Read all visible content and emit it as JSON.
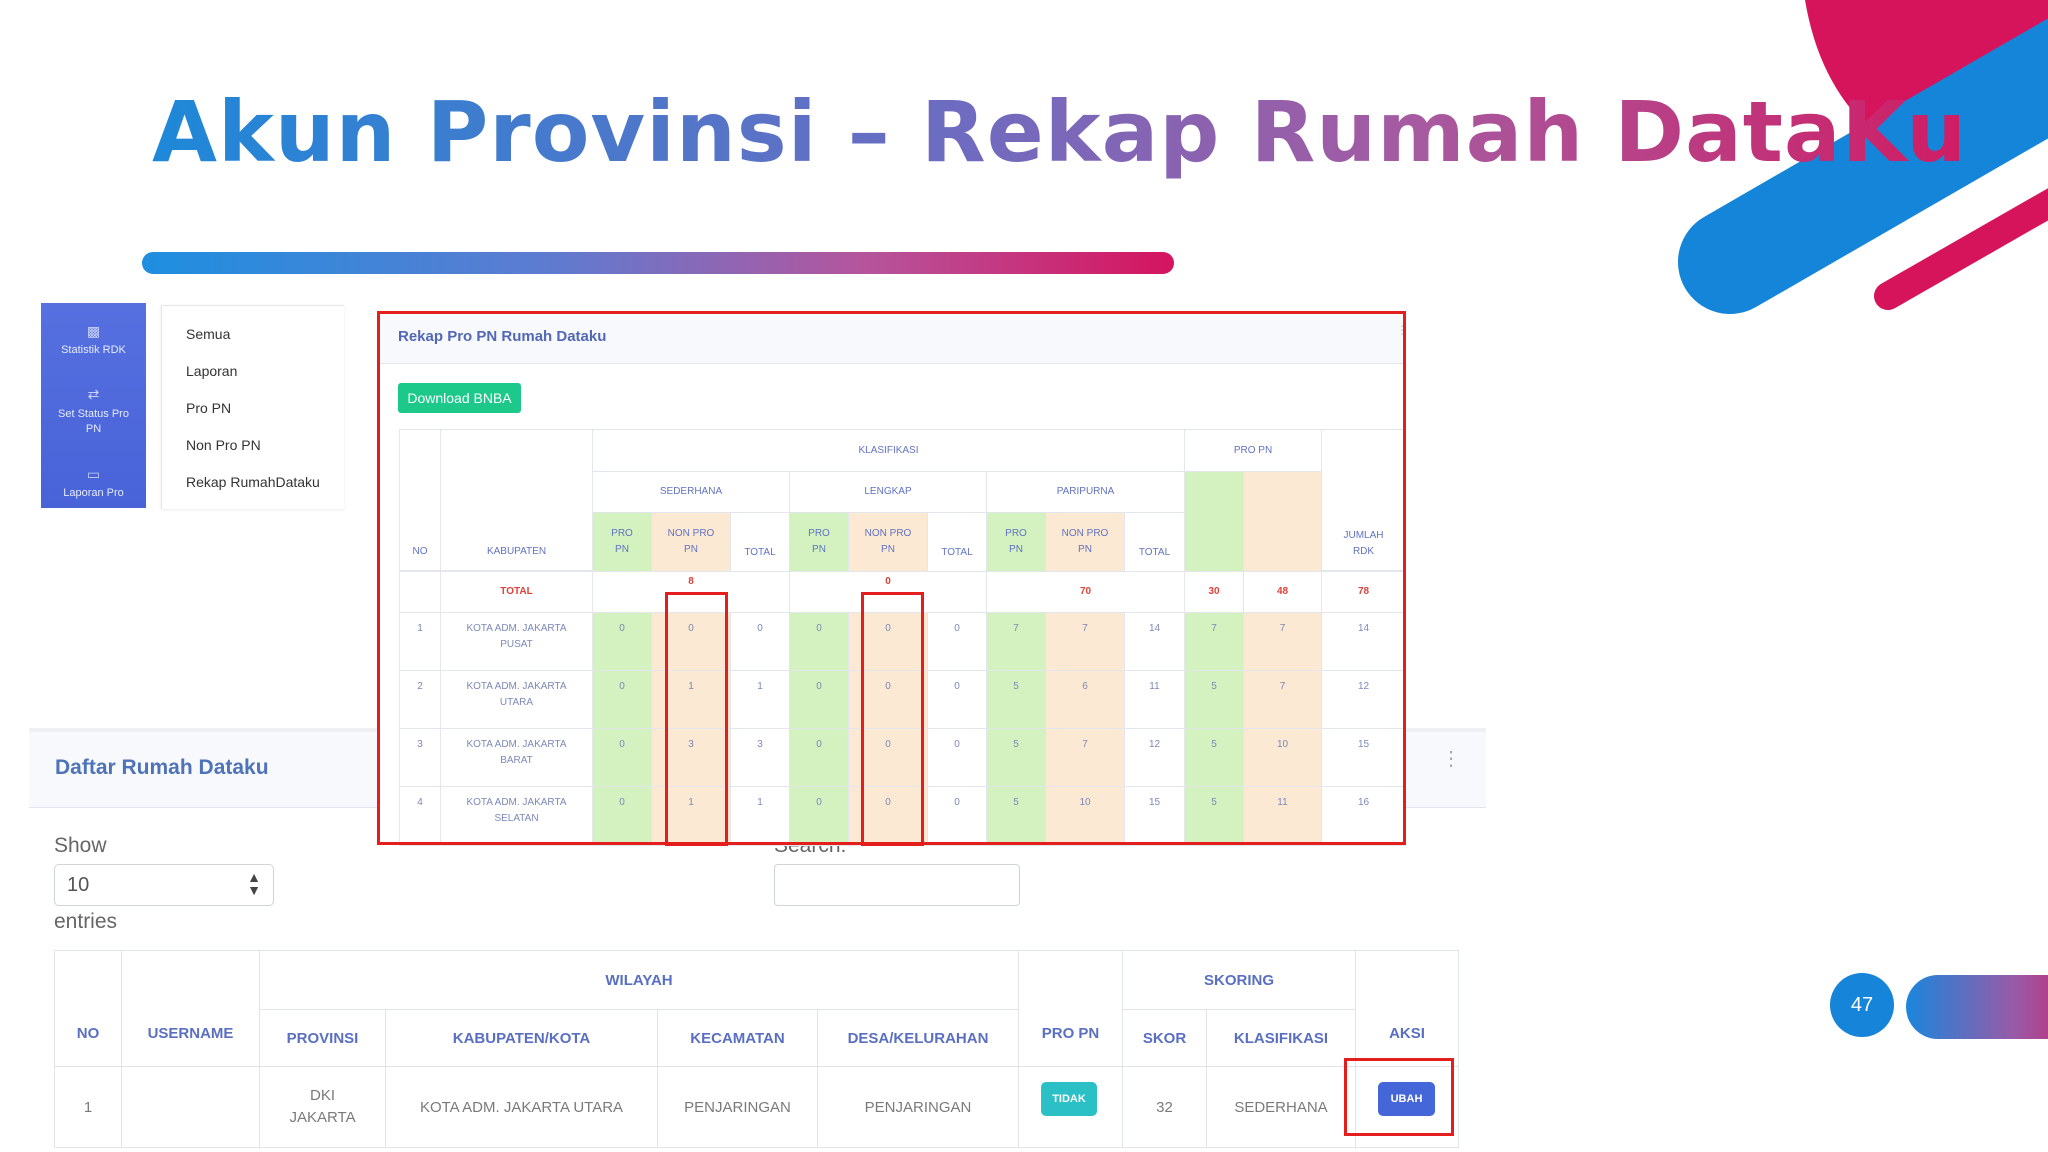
{
  "slide": {
    "title": "Akun Provinsi – Rekap Rumah DataKu",
    "page_number": "47"
  },
  "sidebar": {
    "items": [
      {
        "label": "Statistik RDK",
        "icon": "bar-chart-icon"
      },
      {
        "label": "Set Status Pro PN",
        "icon": "exchange-icon"
      },
      {
        "label": "Laporan Pro",
        "icon": "report-icon"
      }
    ]
  },
  "submenu": {
    "items": [
      "Semua",
      "Laporan",
      "Pro PN",
      "Non Pro PN",
      "Rekap RumahDataku"
    ]
  },
  "rekap": {
    "title": "Rekap Pro PN Rumah Dataku",
    "download_label": "Download BNBA",
    "headers": {
      "no": "NO",
      "kabupaten": "KABUPATEN",
      "klasifikasi": "KLASIFIKASI",
      "pro_pn_group": "PRO PN",
      "sederhana": "SEDERHANA",
      "lengkap": "LENGKAP",
      "paripurna": "PARIPURNA",
      "pro": "PRO PN",
      "nonpro": "NON PRO PN",
      "total": "TOTAL",
      "jumlah": "JUMLAH RDK"
    },
    "total_row": {
      "label": "TOTAL",
      "s_nonpro": "8",
      "l_nonpro": "0",
      "p_nonpro": "70",
      "pro": "30",
      "nonpro": "48",
      "jumlah": "78"
    },
    "rows": [
      {
        "no": "1",
        "kab": "KOTA ADM. JAKARTA PUSAT",
        "v": [
          "0",
          "0",
          "0",
          "0",
          "0",
          "0",
          "7",
          "7",
          "14",
          "7",
          "7",
          "14"
        ]
      },
      {
        "no": "2",
        "kab": "KOTA ADM. JAKARTA UTARA",
        "v": [
          "0",
          "1",
          "1",
          "0",
          "0",
          "0",
          "5",
          "6",
          "11",
          "5",
          "7",
          "12"
        ]
      },
      {
        "no": "3",
        "kab": "KOTA ADM. JAKARTA BARAT",
        "v": [
          "0",
          "3",
          "3",
          "0",
          "0",
          "0",
          "5",
          "7",
          "12",
          "5",
          "10",
          "15"
        ]
      },
      {
        "no": "4",
        "kab": "KOTA ADM. JAKARTA SELATAN",
        "v": [
          "0",
          "1",
          "1",
          "0",
          "0",
          "0",
          "5",
          "10",
          "15",
          "5",
          "11",
          "16"
        ]
      }
    ]
  },
  "daftar": {
    "title": "Daftar Rumah Dataku",
    "show_label": "Show",
    "entries_label": "entries",
    "entries_value": "10",
    "search_label": "Search:",
    "headers": {
      "no": "NO",
      "username": "USERNAME",
      "wilayah": "WILAYAH",
      "provinsi": "PROVINSI",
      "kabkota": "KABUPATEN/KOTA",
      "kecamatan": "KECAMATAN",
      "desa": "DESA/KELURAHAN",
      "pro_pn": "PRO PN",
      "skoring": "SKORING",
      "skor": "SKOR",
      "klasifikasi": "KLASIFIKASI",
      "aksi": "AKSI"
    },
    "row": {
      "no": "1",
      "username": "",
      "provinsi": "DKI JAKARTA",
      "kabkota": "KOTA ADM. JAKARTA UTARA",
      "kecamatan": "PENJARINGAN",
      "desa": "PENJARINGAN",
      "pro_pn": "TIDAK",
      "skor": "32",
      "klasifikasi": "SEDERHANA",
      "aksi": "UBAH"
    }
  },
  "colors": {
    "highlight_red": "#e41d1d",
    "pro_green": "#d3f2c0",
    "nonpro_orange": "#fbe9d3",
    "accent_blue": "#1684d8",
    "accent_magenta": "#d5145f"
  }
}
